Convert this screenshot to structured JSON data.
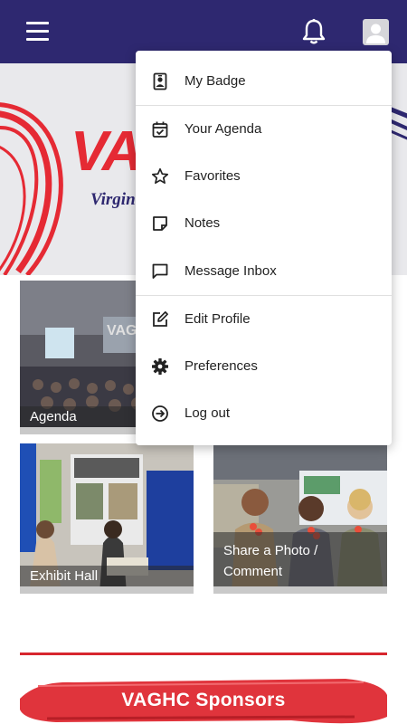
{
  "header": {
    "menu_icon": "hamburger-icon",
    "notification_icon": "bell-icon",
    "profile_icon": "user-avatar-icon",
    "background_color": "#2e2870"
  },
  "hero": {
    "logo_text": "VA",
    "tagline_text": "Virgini"
  },
  "tiles": [
    {
      "label": "Agenda"
    },
    {
      "label": "Exhibit Hall"
    },
    {
      "label": "Share a Photo / Comment"
    }
  ],
  "menu": {
    "items": [
      {
        "label": "My Badge",
        "icon": "badge-icon"
      },
      {
        "label": "Your Agenda",
        "icon": "calendar-check-icon"
      },
      {
        "label": "Favorites",
        "icon": "star-icon"
      },
      {
        "label": "Notes",
        "icon": "note-icon"
      },
      {
        "label": "Message Inbox",
        "icon": "message-icon"
      },
      {
        "label": "Edit Profile",
        "icon": "edit-icon"
      },
      {
        "label": "Preferences",
        "icon": "gear-icon"
      },
      {
        "label": "Log out",
        "icon": "logout-icon"
      }
    ]
  },
  "sponsors": {
    "title": "VAGHC Sponsors",
    "accent_color": "#d7262e"
  }
}
